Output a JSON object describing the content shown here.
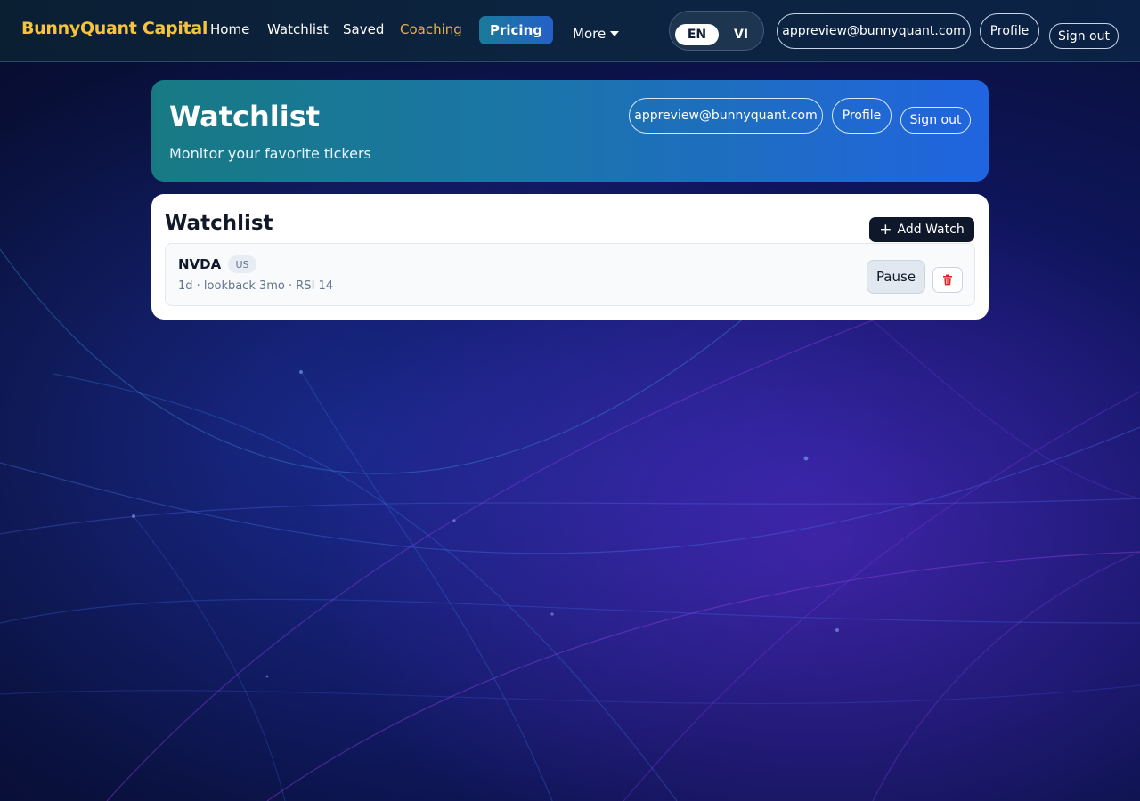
{
  "brand": "BunnyQuant Capital",
  "nav": {
    "home": "Home",
    "watchlist": "Watchlist",
    "saved": "Saved",
    "coaching": "Coaching",
    "pricing": "Pricing",
    "more": "More"
  },
  "lang": {
    "en": "EN",
    "vi": "VI",
    "selected": "EN"
  },
  "account": {
    "email": "appreview@bunnyquant.com",
    "profile": "Profile",
    "signout": "Sign out"
  },
  "hero": {
    "title": "Watchlist",
    "subtitle": "Monitor your favorite tickers"
  },
  "watchlist": {
    "title": "Watchlist",
    "add_label": "Add Watch",
    "items": [
      {
        "ticker": "NVDA",
        "market": "US",
        "meta": "1d · lookback 3mo · RSI 14",
        "action": "Pause"
      }
    ]
  },
  "colors": {
    "brand": "#f5c43a",
    "active_nav": "#e6b34a",
    "delete": "#dc2626"
  },
  "icons": {
    "add": "plus-icon",
    "delete": "trash-icon",
    "more": "chevron-down-icon"
  }
}
